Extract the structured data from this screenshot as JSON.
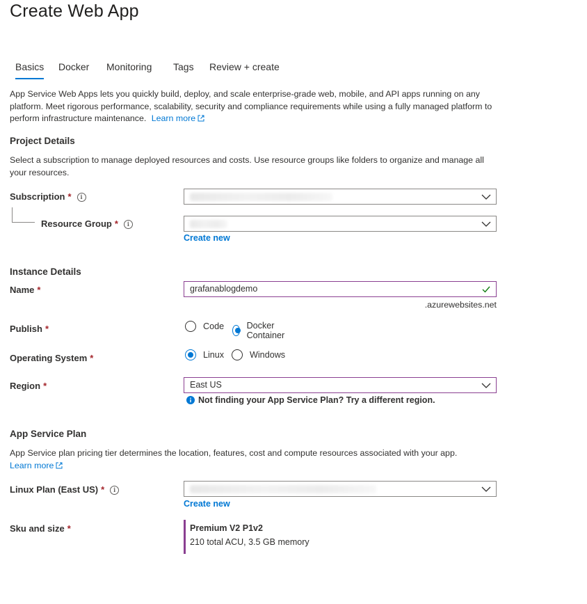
{
  "page": {
    "title": "Create Web App"
  },
  "tabs": [
    {
      "label": "Basics",
      "active": true
    },
    {
      "label": "Docker"
    },
    {
      "label": "Monitoring"
    },
    {
      "label": "Tags"
    },
    {
      "label": "Review + create"
    }
  ],
  "intro": {
    "text": "App Service Web Apps lets you quickly build, deploy, and scale enterprise-grade web, mobile, and API apps running on any platform. Meet rigorous performance, scalability, security and compliance requirements while using a fully managed platform to perform infrastructure maintenance.",
    "learn_more": "Learn more"
  },
  "project_details": {
    "heading": "Project Details",
    "description": "Select a subscription to manage deployed resources and costs. Use resource groups like folders to organize and manage all your resources.",
    "subscription_label": "Subscription",
    "resource_group_label": "Resource Group",
    "create_new": "Create new"
  },
  "instance_details": {
    "heading": "Instance Details",
    "name_label": "Name",
    "name_value": "grafanablogdemo",
    "name_suffix": ".azurewebsites.net",
    "publish_label": "Publish",
    "publish_options": [
      "Code",
      "Docker Container"
    ],
    "publish_selected": "Docker Container",
    "os_label": "Operating System",
    "os_options": [
      "Linux",
      "Windows"
    ],
    "os_selected": "Linux",
    "region_label": "Region",
    "region_value": "East US",
    "region_hint": "Not finding your App Service Plan? Try a different region."
  },
  "app_service_plan": {
    "heading": "App Service Plan",
    "description": "App Service plan pricing tier determines the location, features, cost and compute resources associated with your app.",
    "learn_more": "Learn more",
    "plan_label": "Linux Plan (East US)",
    "create_new": "Create new",
    "sku_label": "Sku and size",
    "sku_name": "Premium V2 P1v2",
    "sku_detail": "210 total ACU, 3.5 GB memory"
  },
  "required_marker": "*",
  "colors": {
    "accent": "#0078d4",
    "required": "#a4262c",
    "focus_border": "#8a3f91",
    "success": "#107c10"
  }
}
